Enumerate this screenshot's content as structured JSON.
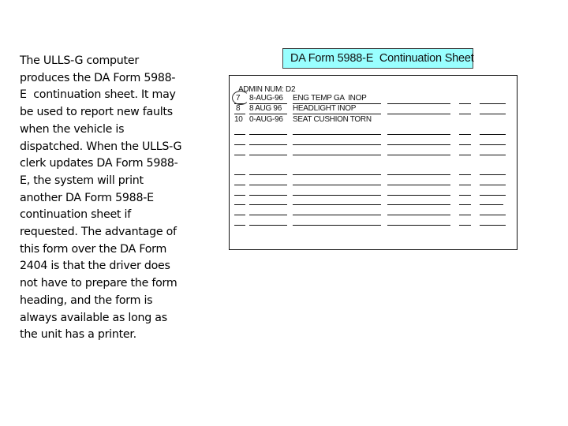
{
  "description": {
    "lines": [
      "The ULLS-G computer",
      "produces the DA Form 5988-",
      "E  continuation sheet. It may",
      "be used to report new faults",
      "when the vehicle is",
      "dispatched. When the ULLS-G",
      "clerk updates DA Form 5988-",
      "E, the system will print",
      "another DA Form 5988-E",
      "continuation sheet if",
      "requested. The advantage of",
      "this form over the DA Form",
      "2404 is that the driver does",
      "not have to prepare the form",
      "heading, and the form is",
      "always available as long as",
      "the unit has a printer."
    ]
  },
  "form": {
    "title": "DA Form 5988-E  Continuation Sheet",
    "header_colors": {
      "title_background": "#99ffff"
    },
    "admin_num_label": "ADMIN NUM: D2",
    "entries": [
      {
        "item": "7",
        "date": "8-AUG-96",
        "fault": "ENG TEMP GA  INOP",
        "circled": true
      },
      {
        "item": "8",
        "date": "8 AUG 96",
        "fault": "HEADLIGHT INOP",
        "circled": false
      },
      {
        "item": "10",
        "date": "0-AUG-96",
        "fault": "SEAT CUSHION TORN",
        "circled": false
      }
    ],
    "blank_rows_group1": 3,
    "blank_rows_group2": 6
  }
}
